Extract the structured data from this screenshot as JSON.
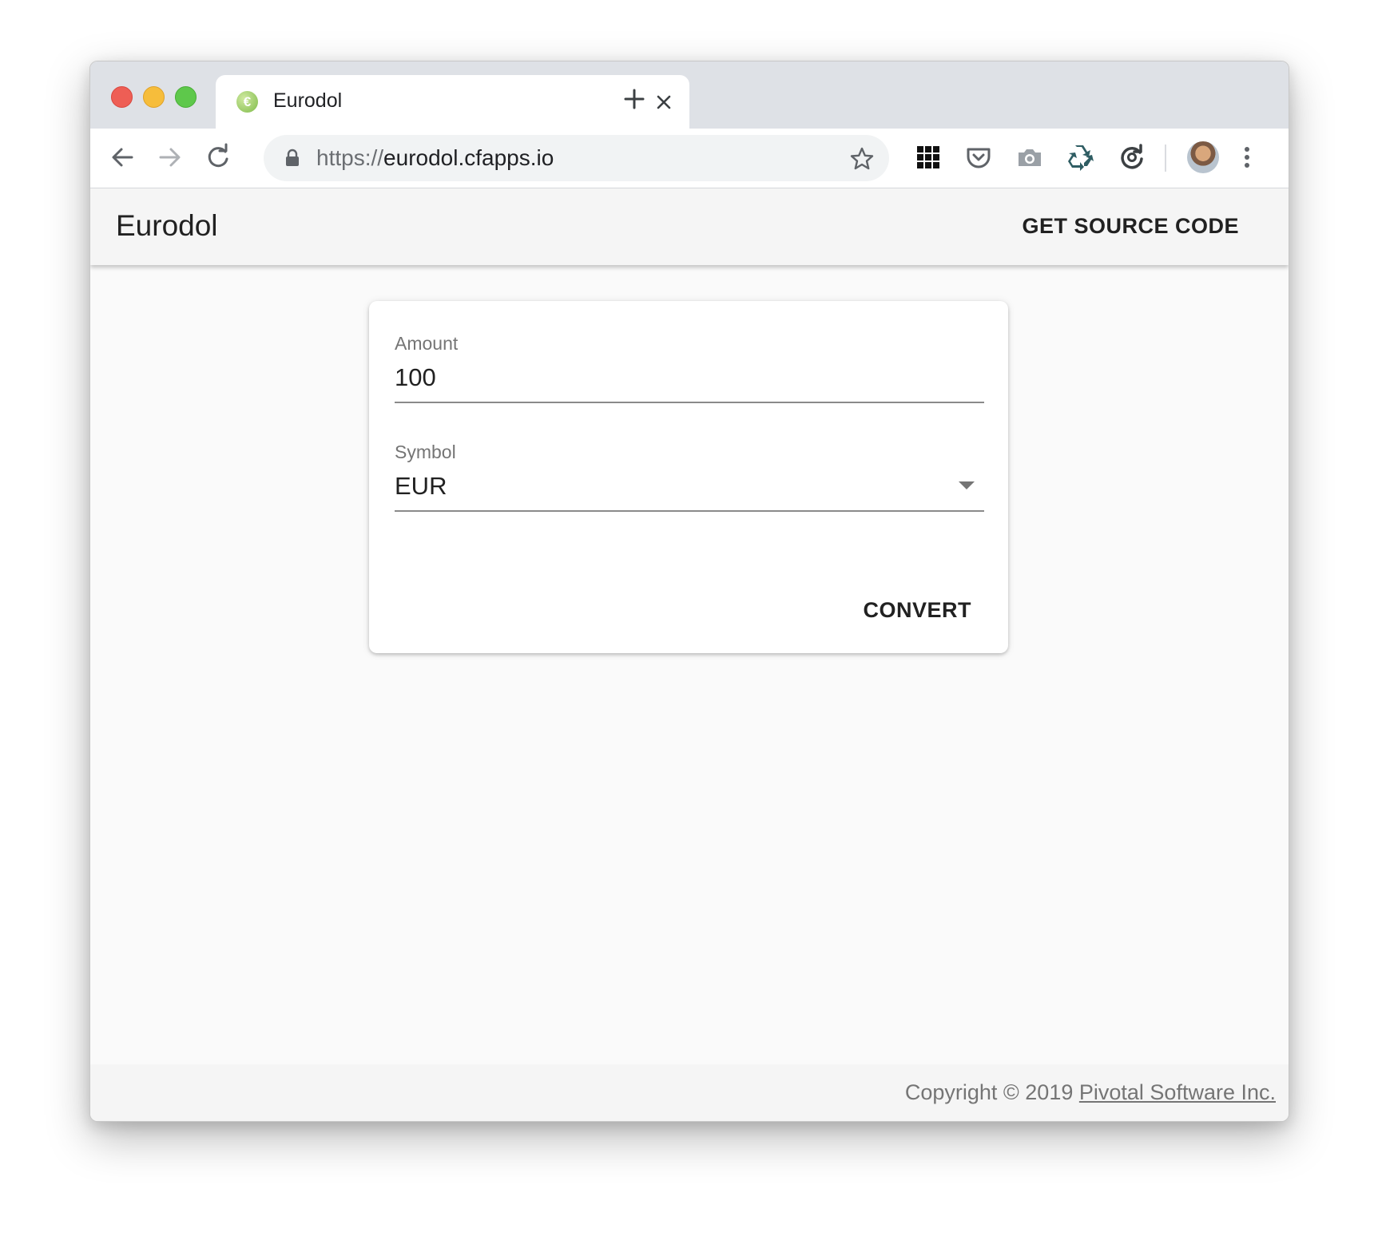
{
  "browser": {
    "tab": {
      "title": "Eurodol",
      "favicon_glyph": "€"
    },
    "omnibox": {
      "url_scheme": "https://",
      "url_host": "eurodol.cfapps.io"
    }
  },
  "app": {
    "title": "Eurodol",
    "source_button": "GET SOURCE CODE"
  },
  "form": {
    "amount_label": "Amount",
    "amount_value": "100",
    "symbol_label": "Symbol",
    "symbol_value": "EUR",
    "convert_button": "CONVERT"
  },
  "footer": {
    "copyright_prefix": "Copyright © 2019 ",
    "company_link": "Pivotal Software Inc."
  },
  "colors": {
    "traffic_red": "#ee5e55",
    "traffic_yellow": "#f6bd3b",
    "traffic_green": "#5ec84b",
    "titlebar": "#dee1e6",
    "appbar": "#f5f5f5"
  }
}
